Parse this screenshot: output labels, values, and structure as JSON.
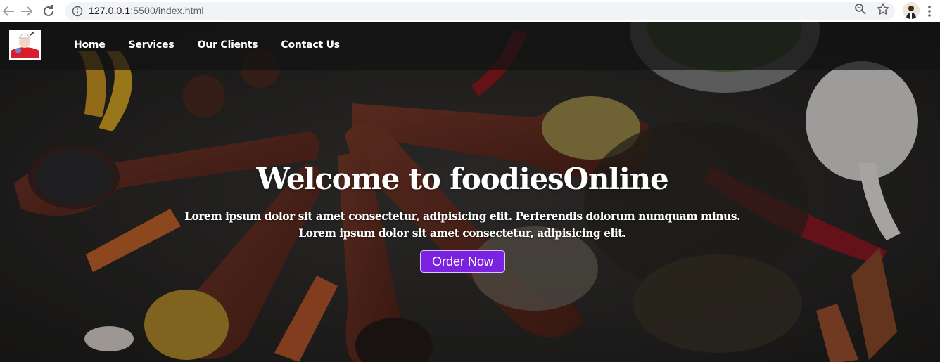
{
  "browser": {
    "url_host": "127.0.0.1",
    "url_rest": ":5500/index.html",
    "icons": [
      "back-icon",
      "forward-icon",
      "reload-icon",
      "info-icon",
      "zoom-icon",
      "star-icon",
      "profile-avatar",
      "menu-icon"
    ]
  },
  "nav": {
    "links": [
      "Home",
      "Services",
      "Our Clients",
      "Contact Us"
    ]
  },
  "hero": {
    "title": "Welcome to foodiesOnline",
    "line1": "Lorem ipsum dolor sit amet consectetur, adipisicing elit. Perferendis dolorum numquam minus.",
    "line2": "Lorem ipsum dolor sit amet consectetur, adipisicing elit.",
    "button_label": "Order Now"
  },
  "colors": {
    "button": "#7a22e0",
    "nav_overlay": "#121212",
    "background": "#2b2b2b"
  }
}
